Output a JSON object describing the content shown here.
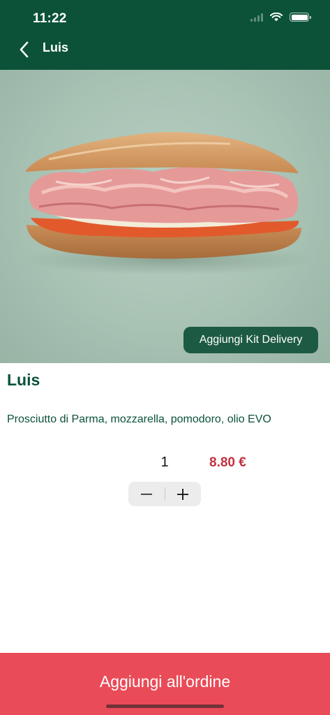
{
  "status_bar": {
    "time": "11:22"
  },
  "nav": {
    "title": "Luis",
    "back_icon": "chevron-left-icon"
  },
  "hero": {
    "kit_button_label": "Aggiungi Kit Delivery"
  },
  "product": {
    "name": "Luis",
    "description": "Prosciutto di Parma, mozzarella, pomodoro, olio EVO",
    "quantity": "1",
    "price": "8.80 €"
  },
  "stepper": {
    "decrement_icon": "minus-icon",
    "increment_icon": "plus-icon"
  },
  "footer": {
    "add_button_label": "Aggiungi all'ordine"
  },
  "colors": {
    "header_bg": "#0b5239",
    "accent_green": "#1d5a43",
    "price_red": "#c0333f",
    "footer_red": "#ea4b58"
  }
}
